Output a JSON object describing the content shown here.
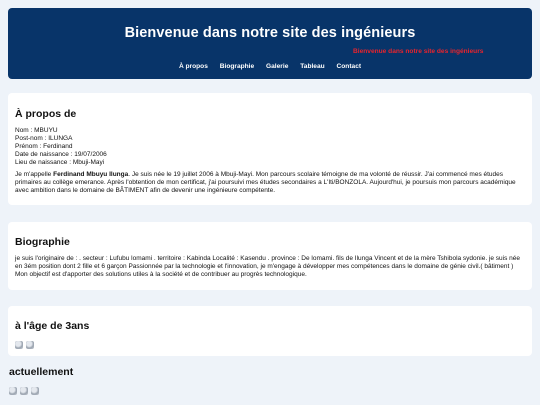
{
  "header": {
    "title": "Bienvenue dans notre site des ingénieurs",
    "marquee": "Bienvenue dans notre site des ingénieurs",
    "nav": [
      "À propos",
      "Biographie",
      "Galerie",
      "Tableau",
      "Contact"
    ]
  },
  "about": {
    "heading": "À propos de",
    "info": [
      "Nom : MBUYU",
      "Post-nom : ILUNGA",
      "Prénom : Ferdinand",
      "Date de naissance : 19/07/2006",
      "Lieu de naissance : Mbuji-Mayi"
    ],
    "desc_prefix": "Je m'appelle ",
    "desc_name": "Ferdinand Mbuyu Ilunga",
    "desc_rest": ". Je suis née le 19 juillet 2006 à Mbuji-Mayi. Mon parcours scolaire témoigne de ma volonté de réussir. J'ai commencé mes études primaires au collège emerance. Après l'obtention de mon certificat, j'ai poursuivi mes études secondaires a L'Iti/BONZOLA. Aujourd'hui, je poursuis mon parcours académique avec ambition dans le domaine de BÂTIMENT afin de devenir une ingénieure compétente."
  },
  "bio": {
    "heading": "Biographie",
    "text": "je suis l'originaire de : . secteur : Lufubu lomami . territoire : Kabinda Localité : Kasendu . province : De lomami. fils de Ilunga Vincent et de la mère Tshibola sydonie. je suis née en 3ém position dont 2 fille et 6 garçon Passionnée par la technologie et l'innovation, je m'engage à développer mes compétences dans le domaine de génie civil.( bâtiment ) Mon objectif est d'apporter des solutions utiles à la société et de contribuer au progrès technologique."
  },
  "age3": {
    "heading": "à l'âge de 3ans",
    "images": [
      "image-1",
      "image-2"
    ]
  },
  "now": {
    "heading": "actuellement",
    "images": [
      "image-1",
      "image-2",
      "image-3"
    ]
  }
}
